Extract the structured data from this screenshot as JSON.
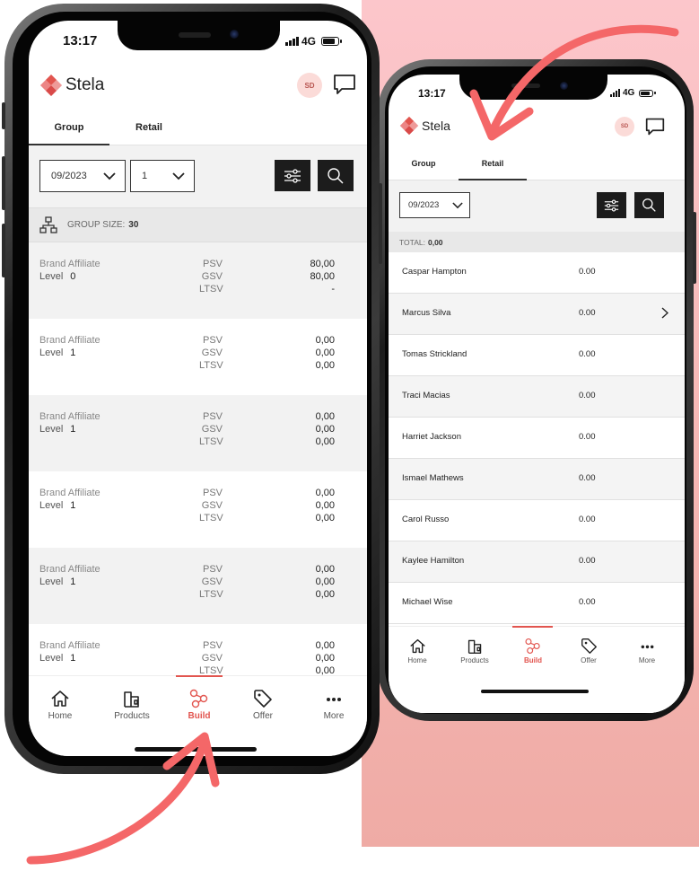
{
  "colors": {
    "accent": "#e2554f",
    "pink_bg": "#fcc6cb",
    "dark_button": "#1c1c1c",
    "arrow": "#f46768"
  },
  "left_phone": {
    "status": {
      "time": "13:17",
      "network": "4G"
    },
    "brand": {
      "name": "Stela",
      "logo_icon": "stela-diamond-logo"
    },
    "avatar_initials": "SD",
    "chat_icon": "chat-bubble-icon",
    "tabs": [
      {
        "label": "Group",
        "active": true
      },
      {
        "label": "Retail",
        "active": false
      }
    ],
    "filters": {
      "period": "09/2023",
      "level": "1",
      "filter_icon": "sliders-icon",
      "search_icon": "search-icon"
    },
    "group_size": {
      "icon": "hierarchy-icon",
      "label": "GROUP SIZE:",
      "value": "30"
    },
    "rows": [
      {
        "role": "Brand Affiliate",
        "level_label": "Level",
        "level": "0",
        "metrics": [
          "PSV",
          "GSV",
          "LTSV"
        ],
        "values": [
          "80,00",
          "80,00",
          "-"
        ]
      },
      {
        "role": "Brand Affiliate",
        "level_label": "Level",
        "level": "1",
        "metrics": [
          "PSV",
          "GSV",
          "LTSV"
        ],
        "values": [
          "0,00",
          "0,00",
          "0,00"
        ]
      },
      {
        "role": "Brand Affiliate",
        "level_label": "Level",
        "level": "1",
        "metrics": [
          "PSV",
          "GSV",
          "LTSV"
        ],
        "values": [
          "0,00",
          "0,00",
          "0,00"
        ]
      },
      {
        "role": "Brand Affiliate",
        "level_label": "Level",
        "level": "1",
        "metrics": [
          "PSV",
          "GSV",
          "LTSV"
        ],
        "values": [
          "0,00",
          "0,00",
          "0,00"
        ]
      },
      {
        "role": "Brand Affiliate",
        "level_label": "Level",
        "level": "1",
        "metrics": [
          "PSV",
          "GSV",
          "LTSV"
        ],
        "values": [
          "0,00",
          "0,00",
          "0,00"
        ]
      },
      {
        "role": "Brand Affiliate",
        "level_label": "Level",
        "level": "1",
        "metrics": [
          "PSV",
          "GSV",
          "LTSV"
        ],
        "values": [
          "0,00",
          "0,00",
          "0,00"
        ]
      }
    ],
    "nav": [
      {
        "label": "Home",
        "icon": "home-icon",
        "active": false
      },
      {
        "label": "Products",
        "icon": "products-icon",
        "active": false
      },
      {
        "label": "Build",
        "icon": "build-network-icon",
        "active": true
      },
      {
        "label": "Offer",
        "icon": "tag-icon",
        "active": false
      },
      {
        "label": "More",
        "icon": "more-dots-icon",
        "active": false
      }
    ]
  },
  "right_phone": {
    "status": {
      "time": "13:17",
      "network": "4G"
    },
    "brand": {
      "name": "Stela",
      "logo_icon": "stela-diamond-logo"
    },
    "avatar_initials": "SD",
    "chat_icon": "chat-bubble-icon",
    "tabs": [
      {
        "label": "Group",
        "active": false
      },
      {
        "label": "Retail",
        "active": true
      }
    ],
    "filters": {
      "period": "09/2023",
      "filter_icon": "sliders-icon",
      "search_icon": "search-icon"
    },
    "total": {
      "label": "TOTAL:",
      "value": "0,00"
    },
    "rows": [
      {
        "name": "Caspar Hampton",
        "value": "0.00",
        "chevron": false
      },
      {
        "name": "Marcus Silva",
        "value": "0.00",
        "chevron": true
      },
      {
        "name": "Tomas Strickland",
        "value": "0.00",
        "chevron": false
      },
      {
        "name": "Traci Macias",
        "value": "0.00",
        "chevron": false
      },
      {
        "name": "Harriet Jackson",
        "value": "0.00",
        "chevron": false
      },
      {
        "name": "Ismael Mathews",
        "value": "0.00",
        "chevron": false
      },
      {
        "name": "Carol Russo",
        "value": "0.00",
        "chevron": false
      },
      {
        "name": "Kaylee Hamilton",
        "value": "0.00",
        "chevron": false
      },
      {
        "name": "Michael Wise",
        "value": "0.00",
        "chevron": false
      }
    ],
    "nav": [
      {
        "label": "Home",
        "icon": "home-icon",
        "active": false
      },
      {
        "label": "Products",
        "icon": "products-icon",
        "active": false
      },
      {
        "label": "Build",
        "icon": "build-network-icon",
        "active": true
      },
      {
        "label": "Offer",
        "icon": "tag-icon",
        "active": false
      },
      {
        "label": "More",
        "icon": "more-dots-icon",
        "active": false
      }
    ]
  }
}
